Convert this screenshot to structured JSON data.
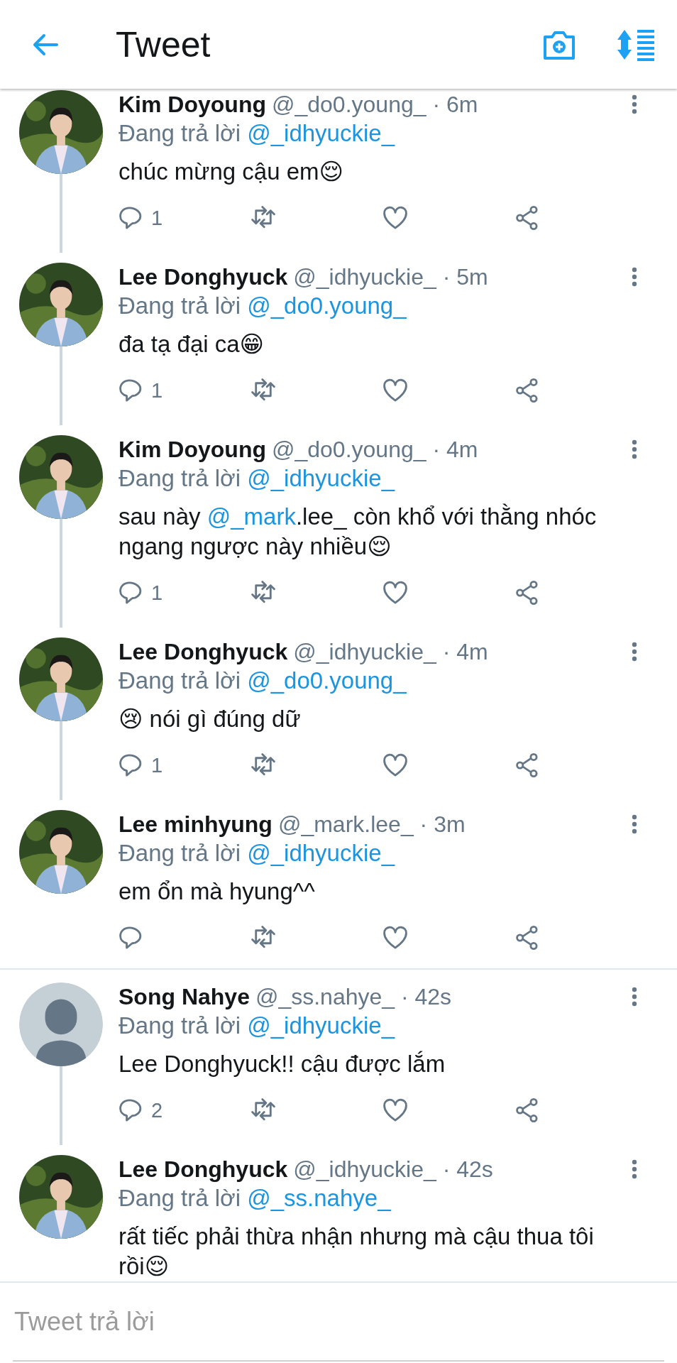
{
  "header": {
    "title": "Tweet"
  },
  "tweets": [
    {
      "name": "Kim Doyoung",
      "meta": "@_do0.young_ · 6m",
      "reply_label": "Đang trả lời",
      "reply_to": "@_idhyuckie_",
      "body": [
        {
          "kind": "text",
          "text": "chúc mừng cậu em😌"
        }
      ],
      "actions": {
        "replies": "1"
      },
      "thread_below": true,
      "divider_before": false
    },
    {
      "name": "Lee Donghyuck",
      "meta": "@_idhyuckie_ · 5m",
      "reply_label": "Đang trả lời",
      "reply_to": "@_do0.young_",
      "body": [
        {
          "kind": "text",
          "text": "đa tạ đại ca😁"
        }
      ],
      "actions": {
        "replies": "1"
      },
      "thread_below": true,
      "divider_before": false
    },
    {
      "name": "Kim Doyoung",
      "meta": "@_do0.young_ · 4m",
      "reply_label": "Đang trả lời",
      "reply_to": "@_idhyuckie_",
      "body": [
        {
          "kind": "text",
          "text": "sau này "
        },
        {
          "kind": "mention",
          "text": "@_mark"
        },
        {
          "kind": "text",
          "text": ".lee_ còn khổ với thằng nhóc ngang ngược này nhiều😌"
        }
      ],
      "actions": {
        "replies": "1"
      },
      "thread_below": true,
      "divider_before": false
    },
    {
      "name": "Lee Donghyuck",
      "meta": "@_idhyuckie_ · 4m",
      "reply_label": "Đang trả lời",
      "reply_to": "@_do0.young_",
      "body": [
        {
          "kind": "text",
          "text": "😢 nói gì đúng dữ"
        }
      ],
      "actions": {
        "replies": "1"
      },
      "thread_below": true,
      "divider_before": false
    },
    {
      "name": "Lee minhyung",
      "meta": "@_mark.lee_ · 3m",
      "reply_label": "Đang trả lời",
      "reply_to": "@_idhyuckie_",
      "body": [
        {
          "kind": "text",
          "text": "em ổn mà hyung^^"
        }
      ],
      "actions": {
        "shown": true
      },
      "thread_below": false,
      "divider_before": false
    },
    {
      "avatar": {
        "kind": "default"
      },
      "name": "Song Nahye",
      "meta": "@_ss.nahye_ · 42s",
      "reply_label": "Đang trả lời",
      "reply_to": "@_idhyuckie_",
      "body": [
        {
          "kind": "text",
          "text": "Lee Donghyuck!! cậu được lắm"
        }
      ],
      "actions": {
        "replies": "2"
      },
      "thread_below": true,
      "divider_before": true
    },
    {
      "name": "Lee Donghyuck",
      "meta": "@_idhyuckie_ · 42s",
      "reply_label": "Đang trả lời",
      "reply_to": "@_ss.nahye_",
      "body": [
        {
          "kind": "text",
          "text": "rất tiếc phải thừa nhận nhưng mà cậu thua tôi rồi😌"
        }
      ],
      "thread_below": false,
      "divider_before": false
    }
  ],
  "reply_box": {
    "placeholder": "Tweet trả lời"
  }
}
